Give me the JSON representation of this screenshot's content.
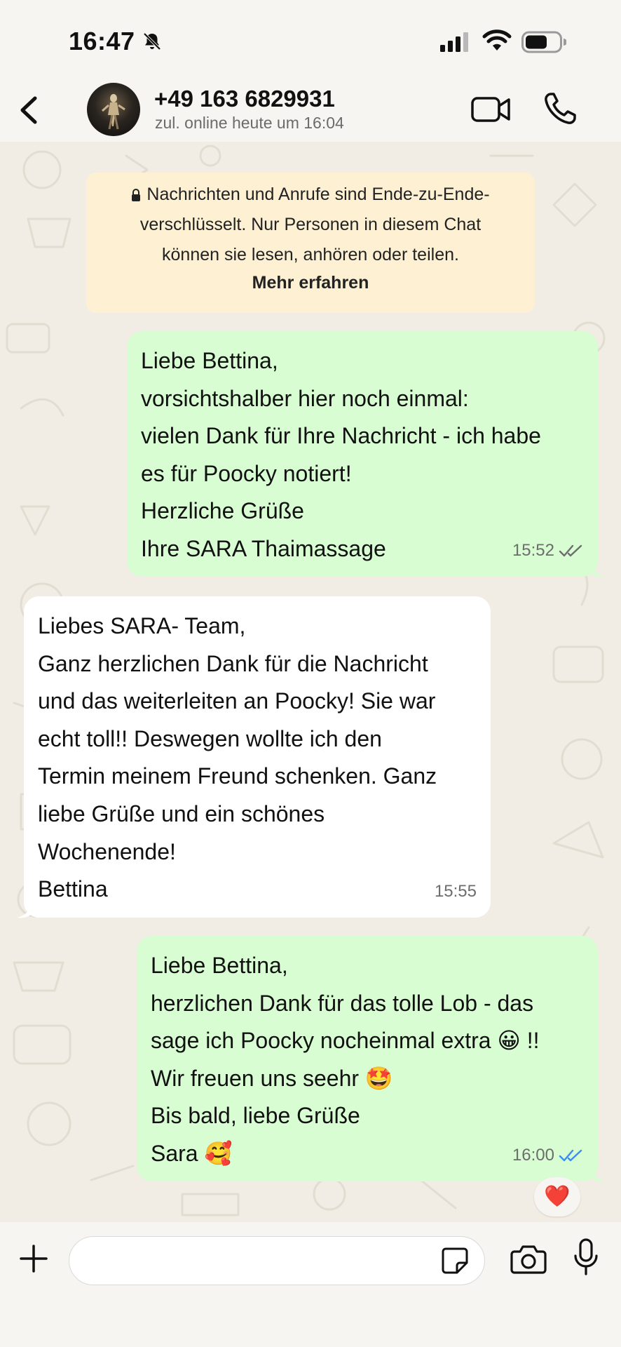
{
  "status_bar": {
    "time": "16:47"
  },
  "header": {
    "contact_name": "+49 163 6829931",
    "contact_status": "zul. online heute um 16:04"
  },
  "encryption_notice": {
    "text_lines": [
      "Nachrichten und Anrufe sind Ende-zu-Ende-",
      "verschlüsselt. Nur Personen in diesem Chat",
      "können sie lesen, anhören oder teilen."
    ],
    "link": "Mehr erfahren"
  },
  "messages": [
    {
      "direction": "outgoing",
      "lines": [
        "Liebe Bettina,",
        "vorsichtshalber hier noch einmal:",
        "vielen Dank für Ihre Nachricht - ich habe",
        "es für Poocky notiert!",
        "Herzliche Grüße",
        "Ihre SARA Thaimassage"
      ],
      "time": "15:52",
      "status": "read-grey"
    },
    {
      "direction": "incoming",
      "lines": [
        "Liebes SARA- Team,",
        "Ganz herzlichen Dank für die Nachricht",
        "und das weiterleiten an Poocky! Sie war",
        "echt toll!! Deswegen wollte ich den",
        "Termin meinem Freund schenken. Ganz",
        "liebe Grüße und ein schönes",
        "Wochenende!",
        "Bettina"
      ],
      "time": "15:55"
    },
    {
      "direction": "outgoing",
      "lines": [
        "Liebe Bettina,",
        "herzlichen Dank für das tolle Lob - das",
        "sage ich Poocky nocheinmal extra 😀 !!",
        "Wir freuen uns seehr 🤩",
        "Bis bald, liebe Grüße",
        "Sara 🥰"
      ],
      "time": "16:00",
      "status": "read-blue",
      "reaction": "❤️"
    }
  ],
  "input": {
    "placeholder": ""
  },
  "colors": {
    "outgoing_bubble": "#d8fdd2",
    "incoming_bubble": "#ffffff",
    "notice_bg": "#fdf0d3",
    "read_blue": "#3b8ef0",
    "chat_bg": "#f1ede4"
  },
  "icons": {
    "status": [
      "bell-off-icon",
      "signal-icon",
      "wifi-icon",
      "battery-icon"
    ],
    "header": [
      "back-chevron-icon",
      "video-camera-icon",
      "phone-icon"
    ],
    "input": [
      "plus-icon",
      "sticker-icon",
      "camera-icon",
      "microphone-icon"
    ]
  }
}
